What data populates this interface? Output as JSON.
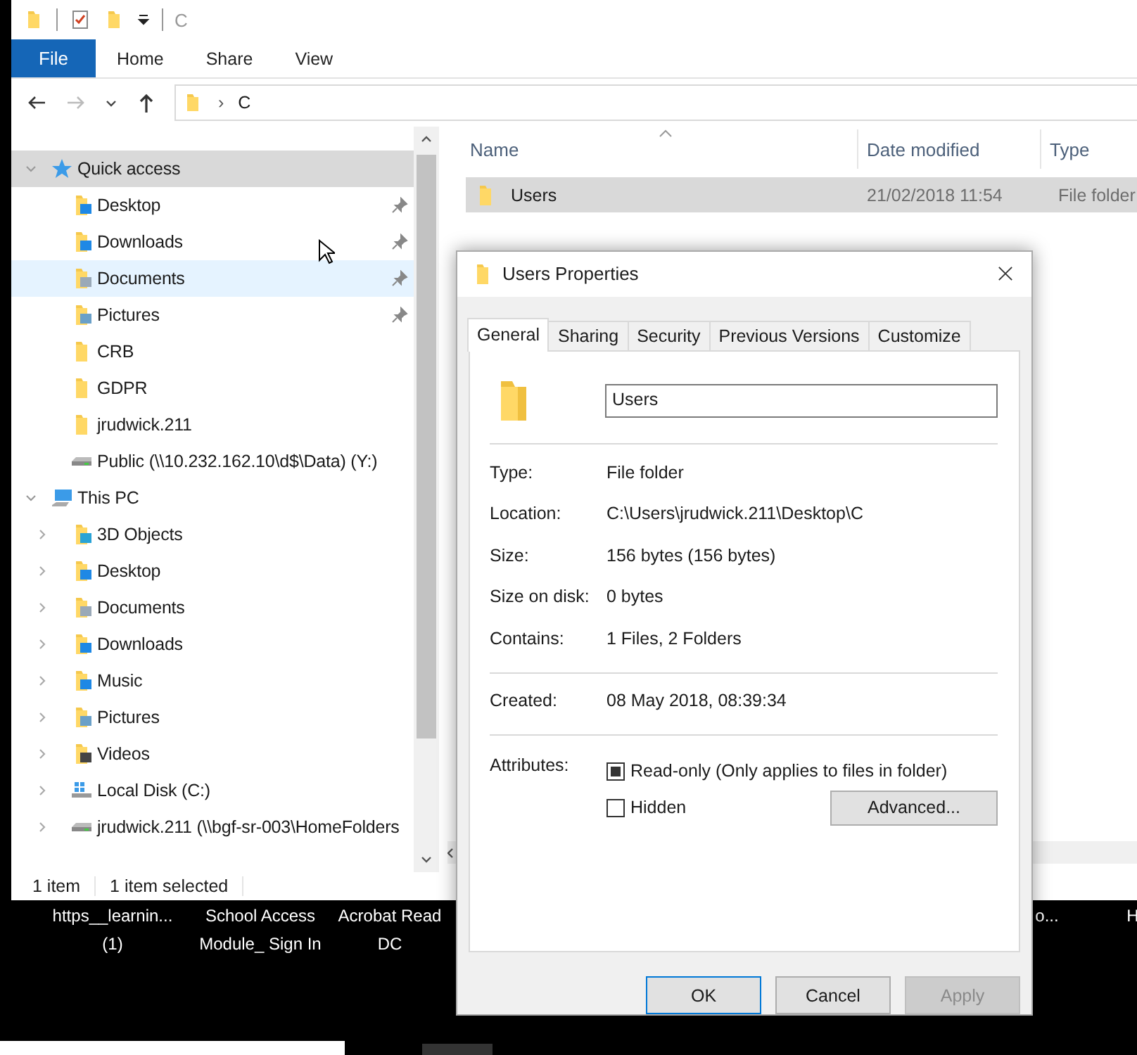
{
  "explorer": {
    "title": "C",
    "ribbon": {
      "file_tab": "File",
      "tabs": [
        "Home",
        "Share",
        "View"
      ]
    },
    "address": {
      "separator": "›",
      "path": "C"
    },
    "nav_tree": [
      {
        "label": "Quick access",
        "kind": "star",
        "expanded": true,
        "selected": true,
        "hovered": false,
        "children": [
          {
            "label": "Desktop",
            "kind": "desktop",
            "pinned": true,
            "selected": false,
            "hovered": false
          },
          {
            "label": "Downloads",
            "kind": "downloads",
            "pinned": true,
            "selected": false,
            "hovered": false
          },
          {
            "label": "Documents",
            "kind": "documents",
            "pinned": true,
            "selected": false,
            "hovered": true
          },
          {
            "label": "Pictures",
            "kind": "pictures",
            "pinned": true,
            "selected": false,
            "hovered": false
          },
          {
            "label": "CRB",
            "kind": "folder",
            "pinned": false,
            "selected": false,
            "hovered": false
          },
          {
            "label": "GDPR",
            "kind": "folder",
            "pinned": false,
            "selected": false,
            "hovered": false
          },
          {
            "label": "jrudwick.211",
            "kind": "folder",
            "pinned": false,
            "selected": false,
            "hovered": false
          },
          {
            "label": "Public (\\\\10.232.162.10\\d$\\Data) (Y:)",
            "kind": "network-drive",
            "pinned": false,
            "selected": false,
            "hovered": false
          }
        ]
      },
      {
        "label": "This PC",
        "kind": "pc",
        "expanded": true,
        "selected": false,
        "hovered": false,
        "children": [
          {
            "label": "3D Objects",
            "kind": "cube",
            "expanded": false,
            "selected": false,
            "hovered": false
          },
          {
            "label": "Desktop",
            "kind": "desktop",
            "expanded": false,
            "selected": false,
            "hovered": false
          },
          {
            "label": "Documents",
            "kind": "documents",
            "expanded": false,
            "selected": false,
            "hovered": false
          },
          {
            "label": "Downloads",
            "kind": "downloads",
            "expanded": false,
            "selected": false,
            "hovered": false
          },
          {
            "label": "Music",
            "kind": "music",
            "expanded": false,
            "selected": false,
            "hovered": false
          },
          {
            "label": "Pictures",
            "kind": "pictures",
            "expanded": false,
            "selected": false,
            "hovered": false
          },
          {
            "label": "Videos",
            "kind": "videos",
            "expanded": false,
            "selected": false,
            "hovered": false
          },
          {
            "label": "Local Disk (C:)",
            "kind": "local-disk",
            "expanded": false,
            "selected": false,
            "hovered": false
          },
          {
            "label": "jrudwick.211 (\\\\bgf-sr-003\\HomeFolders",
            "kind": "network-drive",
            "expanded": false,
            "selected": false,
            "hovered": false
          }
        ]
      }
    ],
    "file_list": {
      "columns": [
        "Name",
        "Date modified",
        "Type"
      ],
      "rows": [
        {
          "name": "Users",
          "date_modified": "21/02/2018 11:54",
          "type": "File folder",
          "selected": true
        }
      ]
    },
    "status_bar": {
      "count": "1 item",
      "selection": "1 item selected"
    }
  },
  "desktop_icons": [
    {
      "lines": [
        "https__learnin...",
        "(1)"
      ]
    },
    {
      "lines": [
        "School Access",
        "Module_ Sign In"
      ]
    },
    {
      "lines": [
        "Acrobat Read",
        "DC"
      ]
    },
    {
      "lines": [
        "o..."
      ]
    },
    {
      "lines": [
        "H"
      ]
    }
  ],
  "properties_dialog": {
    "title": "Users Properties",
    "tabs": [
      {
        "label": "General",
        "selected": true
      },
      {
        "label": "Sharing",
        "selected": false
      },
      {
        "label": "Security",
        "selected": false
      },
      {
        "label": "Previous Versions",
        "selected": false
      },
      {
        "label": "Customize",
        "selected": false
      }
    ],
    "name": "Users",
    "groups": [
      [
        {
          "label": "Type:",
          "value": "File folder"
        },
        {
          "label": "Location:",
          "value": "C:\\Users\\jrudwick.211\\Desktop\\C"
        },
        {
          "label": "Size:",
          "value": "156 bytes (156 bytes)"
        },
        {
          "label": "Size on disk:",
          "value": "0 bytes"
        },
        {
          "label": "Contains:",
          "value": "1 Files, 2 Folders"
        }
      ],
      [
        {
          "label": "Created:",
          "value": "08 May 2018, 08:39:34"
        }
      ]
    ],
    "attributes": {
      "label": "Attributes:",
      "options": [
        {
          "label": "Read-only (Only applies to files in folder)",
          "checked": true
        },
        {
          "label": "Hidden",
          "checked": false
        }
      ],
      "advanced_button": "Advanced..."
    },
    "buttons": [
      {
        "label": "OK",
        "kind": "default",
        "disabled": false
      },
      {
        "label": "Cancel",
        "kind": "normal",
        "disabled": false
      },
      {
        "label": "Apply",
        "kind": "normal",
        "disabled": true
      }
    ]
  }
}
